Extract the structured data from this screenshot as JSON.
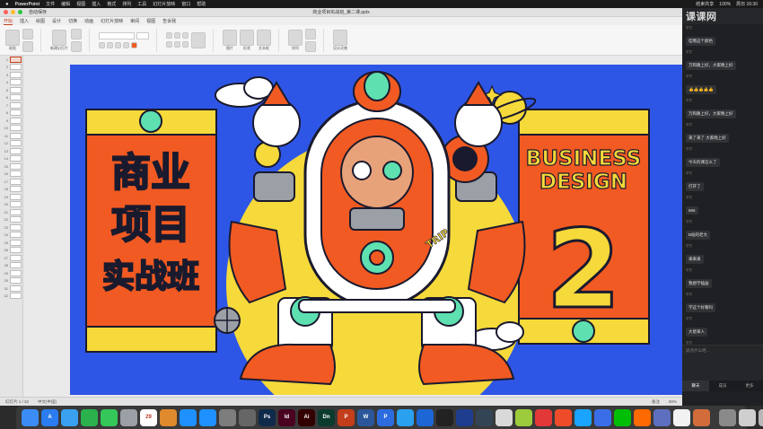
{
  "menubar": {
    "app": "PowerPoint",
    "items": [
      "文件",
      "编辑",
      "视图",
      "插入",
      "格式",
      "排列",
      "工具",
      "幻灯片放映",
      "窗口",
      "帮助"
    ],
    "right": [
      "结束共享",
      "100%",
      "周日 16:30"
    ]
  },
  "window": {
    "title": "商业项目实战班_第二课.pptx",
    "autosave": "自动保存"
  },
  "ribbon": {
    "tabs": [
      "开始",
      "插入",
      "绘图",
      "设计",
      "切换",
      "动画",
      "幻灯片放映",
      "审阅",
      "视图",
      "告诉我"
    ],
    "active_tab": "开始",
    "paste": "粘贴",
    "new_slide": "新建幻灯片",
    "picture": "图片",
    "shape": "形状",
    "textbox": "文本框",
    "arrange": "排列",
    "designer": "设计灵感"
  },
  "slides": {
    "count": 32,
    "selected": 1
  },
  "slide": {
    "left_title_lines": [
      "商业",
      "项目",
      "实战班"
    ],
    "right_title_lines": [
      "BUSINESS",
      "DESIGN"
    ],
    "big_number": "2",
    "robot_badge": "TRIP",
    "colors": {
      "bg": "#2e56e6",
      "orange": "#f15a22",
      "yellow": "#f6d93a",
      "mint": "#5ee0b0",
      "ink": "#1a1a2e",
      "white": "#ffffff"
    }
  },
  "statusbar": {
    "slide_info": "幻灯片 1 / 32",
    "language": "中文(中国)",
    "notes": "备注",
    "zoom": "80%"
  },
  "chat": {
    "watermark": "课课网",
    "messages": [
      {
        "user": "学员",
        "text": "哇哦这个颜色"
      },
      {
        "user": "学员",
        "text": "万和路上好，大家晚上好"
      },
      {
        "user": "学员",
        "text": "👍👍👍👍👍"
      },
      {
        "user": "学员",
        "text": "万和路上好，大家晚上好"
      },
      {
        "user": "学员",
        "text": "来了来了 大家晚上好"
      },
      {
        "user": "学员",
        "text": "今天的课怎么了"
      },
      {
        "user": "学员",
        "text": "打开了"
      },
      {
        "user": "学员",
        "text": "666"
      },
      {
        "user": "学员",
        "text": "B站的老大"
      },
      {
        "user": "学员",
        "text": "来来来"
      },
      {
        "user": "学员",
        "text": "我想学插画"
      },
      {
        "user": "学员",
        "text": "学这个好看吗"
      },
      {
        "user": "学员",
        "text": "大佬来人"
      },
      {
        "user": "学员",
        "text": "我叫这个老师"
      },
      {
        "user": "学员",
        "text": "大佬"
      }
    ],
    "input_placeholder": "说点什么吧…",
    "tabs": [
      "聊天",
      "成员",
      "更多"
    ]
  },
  "dock": {
    "apps": [
      {
        "name": "finder-icon",
        "label": "",
        "color": "#3b8cf5"
      },
      {
        "name": "app-store-icon",
        "label": "A",
        "color": "#2a7cf0"
      },
      {
        "name": "safari-icon",
        "label": "",
        "color": "#3aa0f0"
      },
      {
        "name": "wechat-icon",
        "label": "",
        "color": "#2bb24c"
      },
      {
        "name": "messages-icon",
        "label": "",
        "color": "#35c759"
      },
      {
        "name": "finder-window-icon",
        "label": "",
        "color": "#9aa0a6"
      },
      {
        "name": "calendar-icon",
        "label": "29",
        "color": "#ffffff"
      },
      {
        "name": "books-icon",
        "label": "",
        "color": "#e08a2e"
      },
      {
        "name": "qq-icon",
        "label": "",
        "color": "#1e90ff"
      },
      {
        "name": "qq2-icon",
        "label": "",
        "color": "#1e90ff"
      },
      {
        "name": "settings-icon",
        "label": "",
        "color": "#7d7d7d"
      },
      {
        "name": "font-icon",
        "label": "",
        "color": "#666666"
      },
      {
        "name": "photoshop-icon",
        "label": "Ps",
        "color": "#0f2a4a"
      },
      {
        "name": "indesign-icon",
        "label": "Id",
        "color": "#49021f"
      },
      {
        "name": "illustrator-icon",
        "label": "Ai",
        "color": "#330000"
      },
      {
        "name": "dimension-icon",
        "label": "Dn",
        "color": "#0a3b2e"
      },
      {
        "name": "powerpoint-icon",
        "label": "P",
        "color": "#c43e1c"
      },
      {
        "name": "word-icon",
        "label": "W",
        "color": "#2b579a"
      },
      {
        "name": "p-app-icon",
        "label": "P",
        "color": "#2d6cdf"
      },
      {
        "name": "streaming-icon",
        "label": "",
        "color": "#2aa0f0"
      },
      {
        "name": "wave-icon",
        "label": "",
        "color": "#1c66d6"
      },
      {
        "name": "obs-icon",
        "label": "",
        "color": "#222222"
      },
      {
        "name": "cinema4d-icon",
        "label": "",
        "color": "#1e3d8f"
      },
      {
        "name": "c4d-icon",
        "label": "",
        "color": "#334455"
      },
      {
        "name": "tool-icon",
        "label": "",
        "color": "#d9d9d9"
      },
      {
        "name": "clover-icon",
        "label": "",
        "color": "#9ccc3b"
      },
      {
        "name": "netease-icon",
        "label": "",
        "color": "#e23838"
      },
      {
        "name": "video-icon",
        "label": "",
        "color": "#ee4b2b"
      },
      {
        "name": "media-icon",
        "label": "",
        "color": "#1aa3ff"
      },
      {
        "name": "browser-icon",
        "label": "",
        "color": "#3a6ee8"
      },
      {
        "name": "iqiyi-icon",
        "label": "",
        "color": "#00be06"
      },
      {
        "name": "tencent-video-icon",
        "label": "",
        "color": "#ff6a00"
      },
      {
        "name": "quicktime-icon",
        "label": "",
        "color": "#5f6fbf"
      },
      {
        "name": "notes-icon",
        "label": "",
        "color": "#f2f2f2"
      },
      {
        "name": "archive-icon",
        "label": "",
        "color": "#d26d3b"
      },
      {
        "name": "preview-icon",
        "label": "",
        "color": "#8a8a8a"
      },
      {
        "name": "screen-icon",
        "label": "",
        "color": "#cfcfcf"
      },
      {
        "name": "trash-icon",
        "label": "",
        "color": "#b8b8b8"
      }
    ]
  }
}
